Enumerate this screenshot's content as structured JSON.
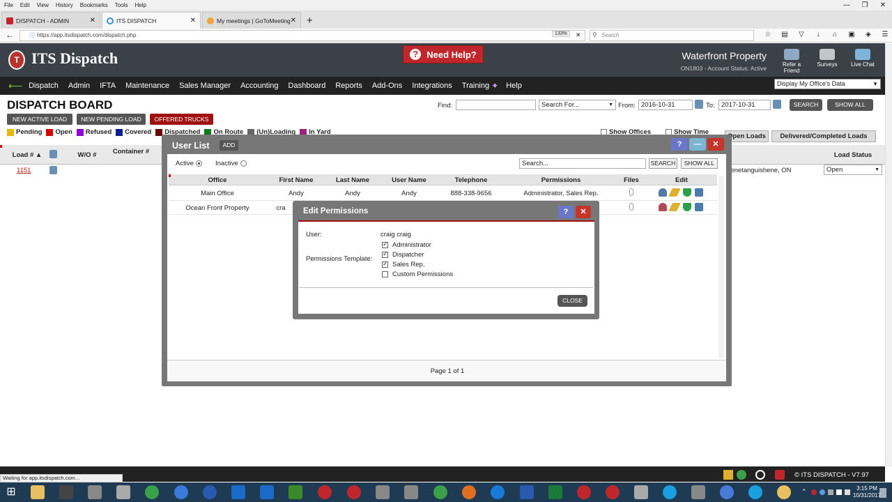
{
  "browser": {
    "menu": [
      "File",
      "Edit",
      "View",
      "History",
      "Bookmarks",
      "Tools",
      "Help"
    ],
    "tabs": [
      {
        "label": "DISPATCH - ADMIN"
      },
      {
        "label": "ITS DISPATCH"
      },
      {
        "label": "My meetings | GoToMeeting"
      }
    ],
    "url": "https://app.itsdispatch.com/dispatch.php",
    "zoom": "133%",
    "search_placeholder": "Search",
    "status": "Waiting for app.itsdispatch.com..."
  },
  "header": {
    "app_name": "ITS Dispatch",
    "need_help": "Need Help?",
    "company": "Waterfront Property",
    "account_line": "ON1803 - Account Status: Active",
    "icons": [
      {
        "label": "Refer a Friend"
      },
      {
        "label": "Surveys"
      },
      {
        "label": "Live Chat"
      }
    ]
  },
  "nav": {
    "items": [
      "Dispatch",
      "Admin",
      "IFTA",
      "Maintenance",
      "Sales Manager",
      "Accounting",
      "Dashboard",
      "Reports",
      "Add-Ons",
      "Integrations",
      "Training",
      "Help"
    ],
    "office_select": "Display My Office's Data"
  },
  "board": {
    "title": "DISPATCH BOARD",
    "buttons": [
      "NEW ACTIVE LOAD",
      "NEW PENDING LOAD",
      "OFFERED TRUCKS"
    ],
    "find_label": "Find:",
    "search_for": "Search For...",
    "from_label": "From:",
    "from_date": "2016-10-31",
    "to_label": "To:",
    "to_date": "2017-10-31",
    "search_btn": "SEARCH",
    "show_all_btn": "SHOW ALL",
    "legend": [
      {
        "label": "Pending",
        "color": "#e6b800"
      },
      {
        "label": "Open",
        "color": "#d40000"
      },
      {
        "label": "Refused",
        "color": "#8b00d4"
      },
      {
        "label": "Covered",
        "color": "#0a1f8f"
      },
      {
        "label": "Dispatched",
        "color": "#6b0000"
      },
      {
        "label": "On Route",
        "color": "#0a7a1a"
      },
      {
        "label": "(Un)Loading",
        "color": "#666666"
      },
      {
        "label": "In Yard",
        "color": "#a0207a"
      }
    ],
    "show_offices": "Show Offices",
    "show_time": "Show Time",
    "tabs": [
      "Open Loads",
      "Delivered/Completed Loads"
    ],
    "columns": [
      "Load #",
      "W/O #",
      "Container #",
      "Load Status"
    ],
    "rows": [
      {
        "load": "1151",
        "city": "Penetanguishene, ON",
        "status": "Open"
      }
    ]
  },
  "user_list": {
    "title": "User List",
    "add_btn": "ADD",
    "active_label": "Active",
    "inactive_label": "Inactive",
    "search_placeholder": "Search...",
    "search_btn": "SEARCH",
    "show_all_btn": "SHOW ALL",
    "columns": [
      "Office",
      "First Name",
      "Last Name",
      "User Name",
      "Telephone",
      "Permissions",
      "Files",
      "Edit"
    ],
    "rows": [
      {
        "office": "Main Office",
        "first": "Andy",
        "last": "Andy",
        "user": "Andy",
        "phone": "888-338-9656",
        "perms": "Administrator, Sales Rep."
      },
      {
        "office": "Ocean Front Property",
        "first": "cra",
        "last": "",
        "user": "",
        "phone": "",
        "perms": "p."
      }
    ],
    "page_info": "Page 1 of 1"
  },
  "permissions": {
    "title": "Edit Permissions",
    "user_label": "User:",
    "user_value": "craig craig",
    "template_label": "Permissions Template:",
    "options": [
      {
        "label": "Administrator",
        "checked": true
      },
      {
        "label": "Dispatcher",
        "checked": true
      },
      {
        "label": "Sales Rep.",
        "checked": true
      },
      {
        "label": "Custom Permissions",
        "checked": false
      }
    ],
    "close_btn": "CLOSE"
  },
  "footer": {
    "version": "© ITS DISPATCH  -  V7.97"
  },
  "taskbar": {
    "time": "3:15 PM",
    "date": "10/31/2017"
  }
}
